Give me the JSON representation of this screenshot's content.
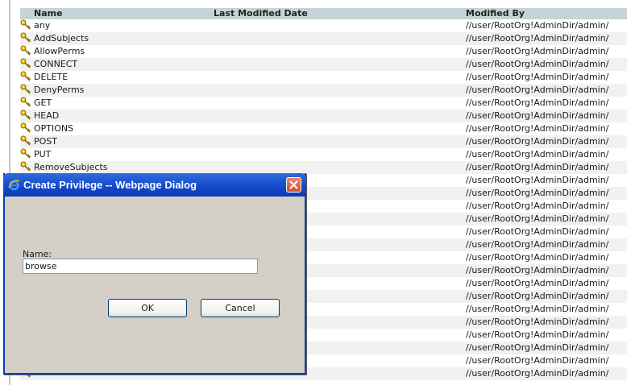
{
  "table": {
    "headers": {
      "name": "Name",
      "last_modified": "Last Modified Date",
      "modified_by": "Modified By"
    },
    "rows": [
      {
        "name": "any",
        "date": "",
        "modified_by": "//user/RootOrg!AdminDir/admin/"
      },
      {
        "name": "AddSubjects",
        "date": "",
        "modified_by": "//user/RootOrg!AdminDir/admin/"
      },
      {
        "name": "AllowPerms",
        "date": "",
        "modified_by": "//user/RootOrg!AdminDir/admin/"
      },
      {
        "name": "CONNECT",
        "date": "",
        "modified_by": "//user/RootOrg!AdminDir/admin/"
      },
      {
        "name": "DELETE",
        "date": "",
        "modified_by": "//user/RootOrg!AdminDir/admin/"
      },
      {
        "name": "DenyPerms",
        "date": "",
        "modified_by": "//user/RootOrg!AdminDir/admin/"
      },
      {
        "name": "GET",
        "date": "",
        "modified_by": "//user/RootOrg!AdminDir/admin/"
      },
      {
        "name": "HEAD",
        "date": "",
        "modified_by": "//user/RootOrg!AdminDir/admin/"
      },
      {
        "name": "OPTIONS",
        "date": "",
        "modified_by": "//user/RootOrg!AdminDir/admin/"
      },
      {
        "name": "POST",
        "date": "",
        "modified_by": "//user/RootOrg!AdminDir/admin/"
      },
      {
        "name": "PUT",
        "date": "",
        "modified_by": "//user/RootOrg!AdminDir/admin/"
      },
      {
        "name": "RemoveSubjects",
        "date": "",
        "modified_by": "//user/RootOrg!AdminDir/admin/"
      },
      {
        "name": "",
        "date": "",
        "modified_by": "//user/RootOrg!AdminDir/admin/"
      },
      {
        "name": "",
        "date": "",
        "modified_by": "//user/RootOrg!AdminDir/admin/"
      },
      {
        "name": "",
        "date": "",
        "modified_by": "//user/RootOrg!AdminDir/admin/"
      },
      {
        "name": "",
        "date": "",
        "modified_by": "//user/RootOrg!AdminDir/admin/"
      },
      {
        "name": "",
        "date": "",
        "modified_by": "//user/RootOrg!AdminDir/admin/"
      },
      {
        "name": "",
        "date": "",
        "modified_by": "//user/RootOrg!AdminDir/admin/"
      },
      {
        "name": "",
        "date": "",
        "modified_by": "//user/RootOrg!AdminDir/admin/"
      },
      {
        "name": "",
        "date": "",
        "modified_by": "//user/RootOrg!AdminDir/admin/"
      },
      {
        "name": "",
        "date": "",
        "modified_by": "//user/RootOrg!AdminDir/admin/"
      },
      {
        "name": "",
        "date": "",
        "modified_by": "//user/RootOrg!AdminDir/admin/"
      },
      {
        "name": "",
        "date": "",
        "modified_by": "//user/RootOrg!AdminDir/admin/"
      },
      {
        "name": "",
        "date": "",
        "modified_by": "//user/RootOrg!AdminDir/admin/"
      },
      {
        "name": "",
        "date": "",
        "modified_by": "//user/RootOrg!AdminDir/admin/"
      },
      {
        "name": "",
        "date": "",
        "modified_by": "//user/RootOrg!AdminDir/admin/"
      },
      {
        "name": "",
        "date": "",
        "modified_by": "//user/RootOrg!AdminDir/admin/"
      },
      {
        "name": "",
        "date": "",
        "modified_by": "//user/RootOrg!AdminDir/admin/"
      }
    ]
  },
  "dialog": {
    "title": "Create Privilege -- Webpage Dialog",
    "name_label": "Name:",
    "name_value": "browse",
    "ok_label": "OK",
    "cancel_label": "Cancel"
  },
  "icons": {
    "row_icon": "key-icon",
    "title_icon": "ie-icon",
    "close_icon": "close-icon"
  },
  "colors": {
    "header_bg": "#c5d4d6",
    "alt_row_bg": "#f1f1f1",
    "titlebar": "#1448c9",
    "close_button": "#d1512b",
    "dialog_bg": "#d4d0c8"
  }
}
